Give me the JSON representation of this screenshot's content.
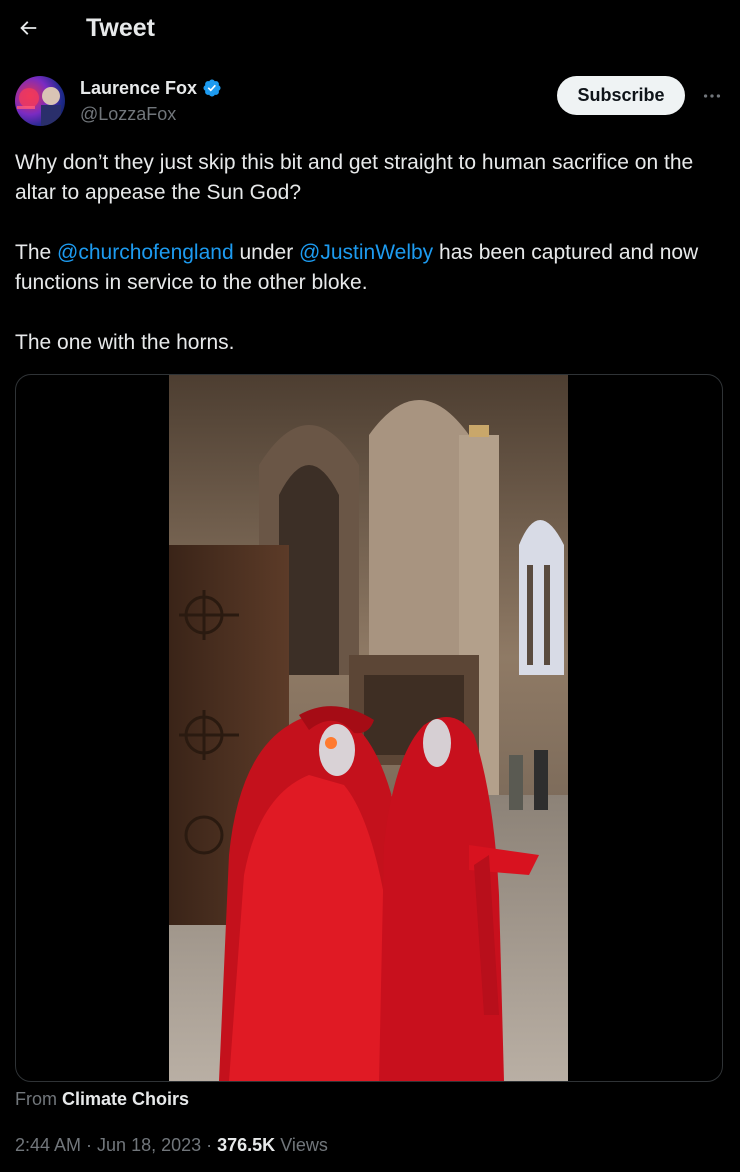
{
  "header": {
    "title": "Tweet",
    "back_icon": "arrow-left-icon"
  },
  "author": {
    "name": "Laurence Fox",
    "handle": "@LozzaFox",
    "verified": true,
    "verified_color": "#1d9bf0"
  },
  "actions": {
    "subscribe_label": "Subscribe",
    "more_icon": "more-horizontal-icon"
  },
  "tweet": {
    "paragraph1": "Why don’t they just skip this bit and get straight to human sacrifice on the altar to appease the Sun God?",
    "p2_before": "The ",
    "p2_mention1": "@churchofengland",
    "p2_middle": " under ",
    "p2_mention2": "@JustinWelby",
    "p2_after": " has been captured and now functions in service to the other bloke.",
    "paragraph3": "The one with the horns."
  },
  "media": {
    "type": "video",
    "description_icon": "video-thumbnail"
  },
  "attribution": {
    "prefix": "From",
    "source": "Climate Choirs"
  },
  "meta": {
    "time": "2:44 AM",
    "sep1": " · ",
    "date": "Jun 18, 2023",
    "sep2": " · ",
    "views_count": "376.5K",
    "views_label": " Views"
  },
  "colors": {
    "background": "#000000",
    "text": "#e7e9ea",
    "secondary": "#71767b",
    "accent": "#1d9bf0",
    "subscribe_bg": "#eff3f4"
  }
}
